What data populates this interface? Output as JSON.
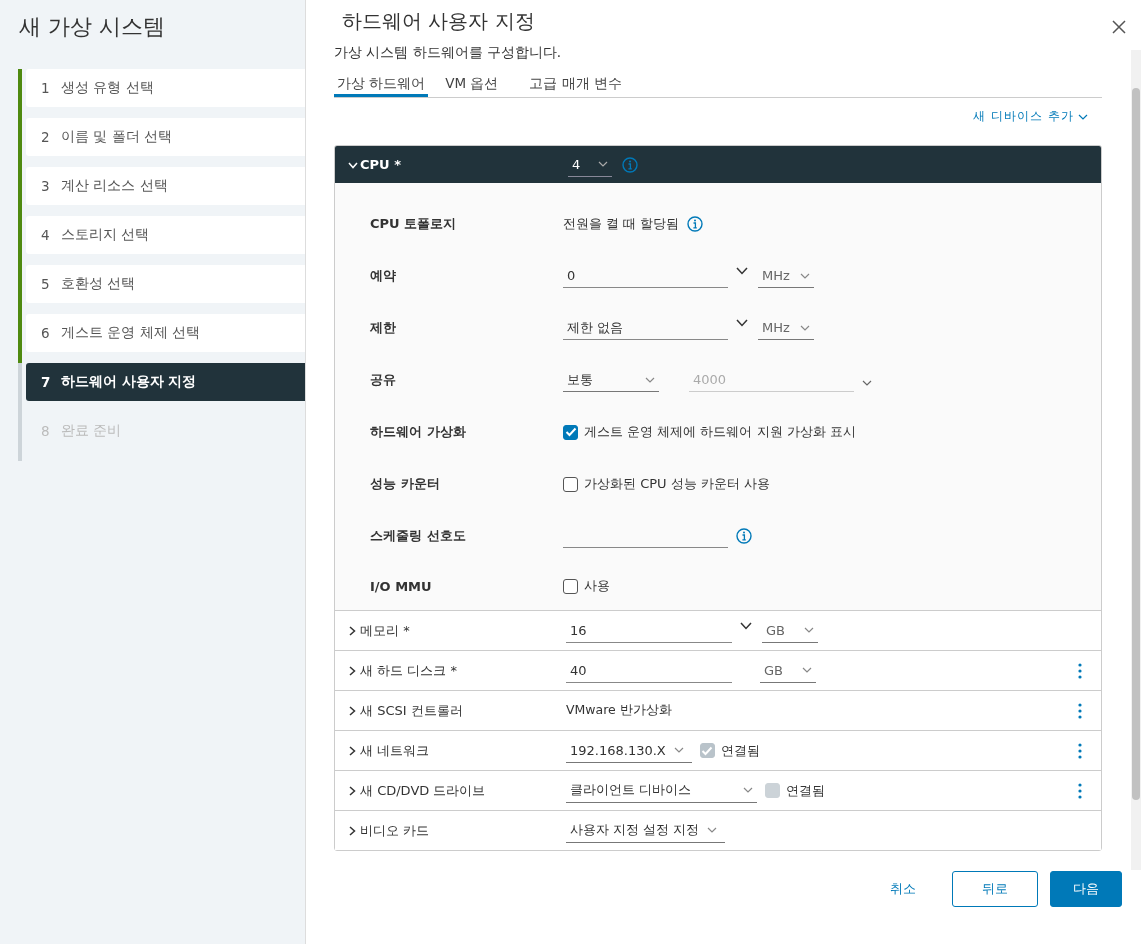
{
  "wizard": {
    "title": "새 가상 시스템",
    "steps": [
      {
        "number": "1",
        "label": "생성 유형 선택",
        "completed": true,
        "selected": false,
        "disabled": false
      },
      {
        "number": "2",
        "label": "이름 및 폴더 선택",
        "completed": true,
        "selected": false,
        "disabled": false
      },
      {
        "number": "3",
        "label": "계산 리소스 선택",
        "completed": true,
        "selected": false,
        "disabled": false
      },
      {
        "number": "4",
        "label": "스토리지 선택",
        "completed": true,
        "selected": false,
        "disabled": false
      },
      {
        "number": "5",
        "label": "호환성 선택",
        "completed": true,
        "selected": false,
        "disabled": false
      },
      {
        "number": "6",
        "label": "게스트 운영 체제 선택",
        "completed": true,
        "selected": false,
        "disabled": false
      },
      {
        "number": "7",
        "label": "하드웨어 사용자 지정",
        "completed": false,
        "selected": true,
        "disabled": false
      },
      {
        "number": "8",
        "label": "완료 준비",
        "completed": false,
        "selected": false,
        "disabled": true
      }
    ]
  },
  "page": {
    "title": "하드웨어 사용자 지정",
    "subtitle": "가상 시스템 하드웨어를 구성합니다.",
    "tabs": [
      {
        "label": "가상 하드웨어",
        "selected": true
      },
      {
        "label": "VM 옵션",
        "selected": false
      },
      {
        "label": "고급 매개 변수",
        "selected": false
      }
    ],
    "add_device": "새 디바이스 추가"
  },
  "cpu": {
    "label": "CPU *",
    "expanded": true,
    "value": "4",
    "info": true,
    "settings": [
      {
        "kind": "text",
        "label": "CPU 토폴로지",
        "value": "전원을 켤 때 할당됨",
        "info": true
      },
      {
        "kind": "input",
        "label": "예약",
        "value": "0",
        "dropdown": true,
        "unit": "MHz"
      },
      {
        "kind": "input",
        "label": "제한",
        "value": "제한 없음",
        "dropdown": true,
        "unit": "MHz"
      },
      {
        "kind": "shares",
        "label": "공유",
        "value": "보통",
        "number": "4000"
      },
      {
        "kind": "checkbox",
        "label": "하드웨어 가상화",
        "checked": true,
        "text": "게스트 운영 체제에 하드웨어 지원 가상화 표시"
      },
      {
        "kind": "checkbox",
        "label": "성능 카운터",
        "checked": false,
        "text": "가상화된 CPU 성능 카운터 사용"
      },
      {
        "kind": "input",
        "label": "스케줄링 선호도",
        "info": true
      },
      {
        "kind": "checkbox",
        "label": "I/O MMU",
        "checked": false,
        "text": "사용"
      }
    ]
  },
  "devices": [
    {
      "kind": "input",
      "label": "메모리 *",
      "expanded": false,
      "value": "16",
      "dropdown": true,
      "unit": "GB",
      "menu": false
    },
    {
      "kind": "input",
      "label": "새 하드 디스크 *",
      "expanded": false,
      "value": "40",
      "unit": "GB",
      "menu": true
    },
    {
      "kind": "text",
      "label": "새 SCSI 컨트롤러",
      "expanded": false,
      "value": "VMware 반가상화",
      "menu": true
    },
    {
      "kind": "select",
      "label": "새 네트워크",
      "expanded": false,
      "value": "192.168.130.X",
      "connected": {
        "checked": true,
        "label": "연결됨"
      },
      "menu": true
    },
    {
      "kind": "select",
      "label": "새 CD/DVD 드라이브",
      "expanded": false,
      "value": "클라이언트 디바이스",
      "wide": true,
      "connected": {
        "checked": false,
        "label": "연결됨"
      },
      "menu": true
    },
    {
      "kind": "select",
      "label": "비디오 카드",
      "expanded": false,
      "value": "사용자 지정 설정 지정",
      "menu": false
    }
  ],
  "footer": {
    "cancel": "취소",
    "back": "뒤로",
    "next": "다음"
  }
}
